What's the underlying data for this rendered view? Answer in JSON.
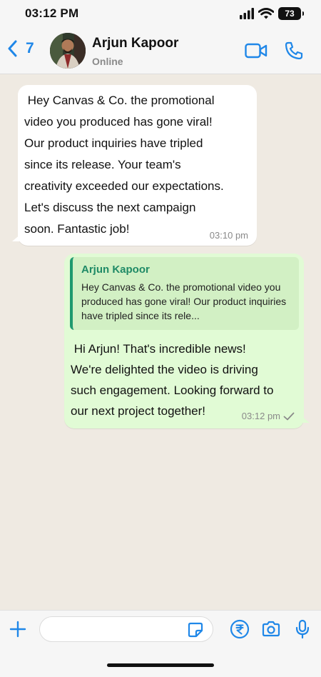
{
  "status_bar": {
    "time": "03:12 PM",
    "battery": "73"
  },
  "header": {
    "back_count": "7",
    "contact_name": "Arjun Kapoor",
    "contact_status": "Online"
  },
  "messages": [
    {
      "direction": "incoming",
      "text": " Hey Canvas & Co. the promotional\nvideo you produced has gone viral!\nOur product inquiries have tripled\nsince its release. Your team's\ncreativity exceeded our expectations.\nLet's discuss the next campaign\nsoon. Fantastic job!",
      "time": "03:10 pm"
    },
    {
      "direction": "outgoing",
      "quote_author": "Arjun Kapoor",
      "quote_text": "Hey Canvas & Co. the promotional video you produced has gone viral! Our product inquiries have tripled since its rele...",
      "text": " Hi Arjun! That's incredible news!\nWe're delighted the video is driving\nsuch engagement. Looking forward to\nour next project together!",
      "time": "03:12 pm",
      "status": "sent"
    }
  ],
  "input": {
    "placeholder": ""
  },
  "colors": {
    "accent": "#1f87e8",
    "chat_background": "#efeae2",
    "outgoing_bubble": "#e1fbd5",
    "incoming_bubble": "#ffffff",
    "quote_accent": "#1f9a6f"
  },
  "icons": {
    "back": "chevron-left-icon",
    "video": "video-camera-icon",
    "call": "phone-icon",
    "plus": "plus-icon",
    "sticker": "sticker-icon",
    "pay": "rupee-payment-icon",
    "camera": "camera-icon",
    "mic": "microphone-icon",
    "tick": "check-icon"
  }
}
